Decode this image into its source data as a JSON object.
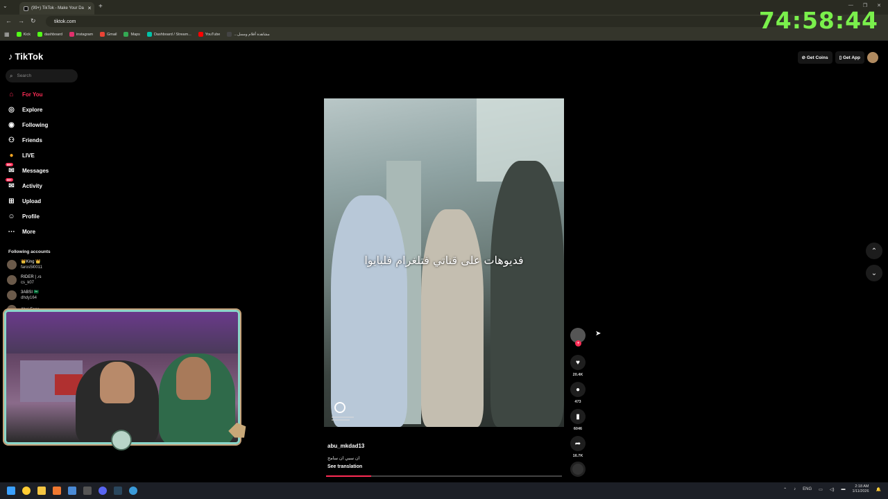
{
  "browser": {
    "tab_title": "(99+) TikTok - Make Your Da",
    "url": "tiktok.com",
    "bookmarks": [
      {
        "label": "Kick",
        "color": "#53fc18"
      },
      {
        "label": "dashboard",
        "color": "#53fc18"
      },
      {
        "label": "instagram",
        "color": "#e1306c"
      },
      {
        "label": "Gmail",
        "color": "#ea4335"
      },
      {
        "label": "Maps",
        "color": "#34a853"
      },
      {
        "label": "Dashboard / Stream...",
        "color": "#00c2a8"
      },
      {
        "label": "YouTube",
        "color": "#ff0000"
      },
      {
        "label": "...مشاهدة أفلام ومسل",
        "color": "#444444"
      }
    ]
  },
  "overlay": {
    "timer": "74:58:44",
    "timer_color": "#7af04c"
  },
  "tiktok": {
    "logo": "TikTok",
    "search_placeholder": "Search",
    "nav": [
      {
        "label": "For You",
        "icon": "home-icon",
        "active": true
      },
      {
        "label": "Explore",
        "icon": "compass-icon"
      },
      {
        "label": "Following",
        "icon": "following-icon"
      },
      {
        "label": "Friends",
        "icon": "friends-icon"
      },
      {
        "label": "LIVE",
        "icon": "live-icon"
      },
      {
        "label": "Messages",
        "icon": "messages-icon",
        "badge": "99+"
      },
      {
        "label": "Activity",
        "icon": "activity-icon",
        "badge": "99+"
      },
      {
        "label": "Upload",
        "icon": "upload-icon"
      },
      {
        "label": "Profile",
        "icon": "profile-icon"
      },
      {
        "label": "More",
        "icon": "more-icon"
      }
    ],
    "following_title": "Following accounts",
    "following": [
      {
        "name": "👑King 👑",
        "handle": "faros5l0011"
      },
      {
        "name": "RIDER | ♪s",
        "handle": "cs_k07"
      },
      {
        "name": "3ABSI 🇸🇦",
        "handle": "dhdy164"
      },
      {
        "name": "Absi Fans",
        "handle": ""
      }
    ],
    "top_right": {
      "get_coins": "Get Coins",
      "get_app": "Get App"
    },
    "video": {
      "caption_overlay": "فديوهات على قناتي فتلغرام فلبايوا",
      "author": "abu_mkdad13",
      "description": "ان سبي ان سامح",
      "see_translation": "See translation",
      "progress": 0.19
    },
    "actions": {
      "likes": "20.4K",
      "comments": "473",
      "saves": "6046",
      "shares": "16.7K"
    },
    "accent": "#fe2c55"
  },
  "taskbar": {
    "lang": "ENG",
    "time": "2:18 AM",
    "date": "1/11/2026"
  }
}
